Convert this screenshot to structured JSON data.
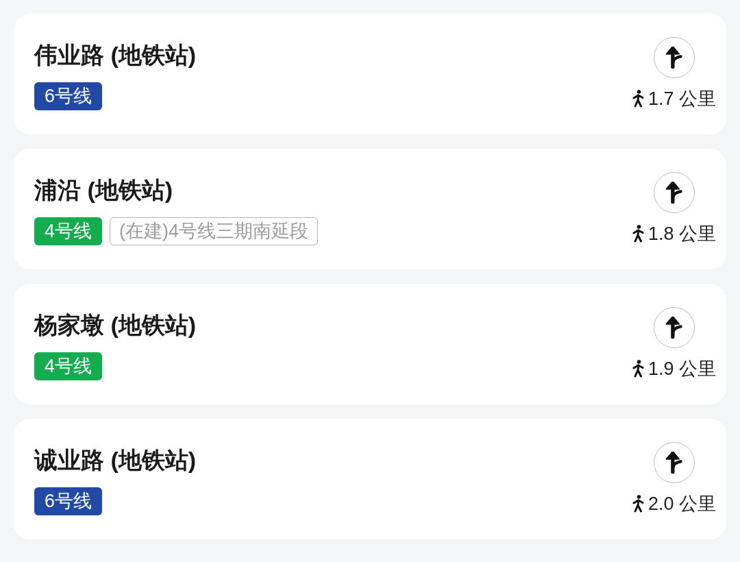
{
  "stations": [
    {
      "name": "伟业路 (地铁站)",
      "tags": [
        {
          "kind": "line",
          "label": "6号线",
          "color": "#2249a6"
        }
      ],
      "distance": "1.7 公里"
    },
    {
      "name": "浦沿 (地铁站)",
      "tags": [
        {
          "kind": "line",
          "label": "4号线",
          "color": "#15ab4f"
        },
        {
          "kind": "planned",
          "label": "(在建)4号线三期南延段"
        }
      ],
      "distance": "1.8 公里"
    },
    {
      "name": "杨家墩 (地铁站)",
      "tags": [
        {
          "kind": "line",
          "label": "4号线",
          "color": "#15ab4f"
        }
      ],
      "distance": "1.9 公里"
    },
    {
      "name": "诚业路 (地铁站)",
      "tags": [
        {
          "kind": "line",
          "label": "6号线",
          "color": "#2249a6"
        }
      ],
      "distance": "2.0 公里"
    }
  ]
}
